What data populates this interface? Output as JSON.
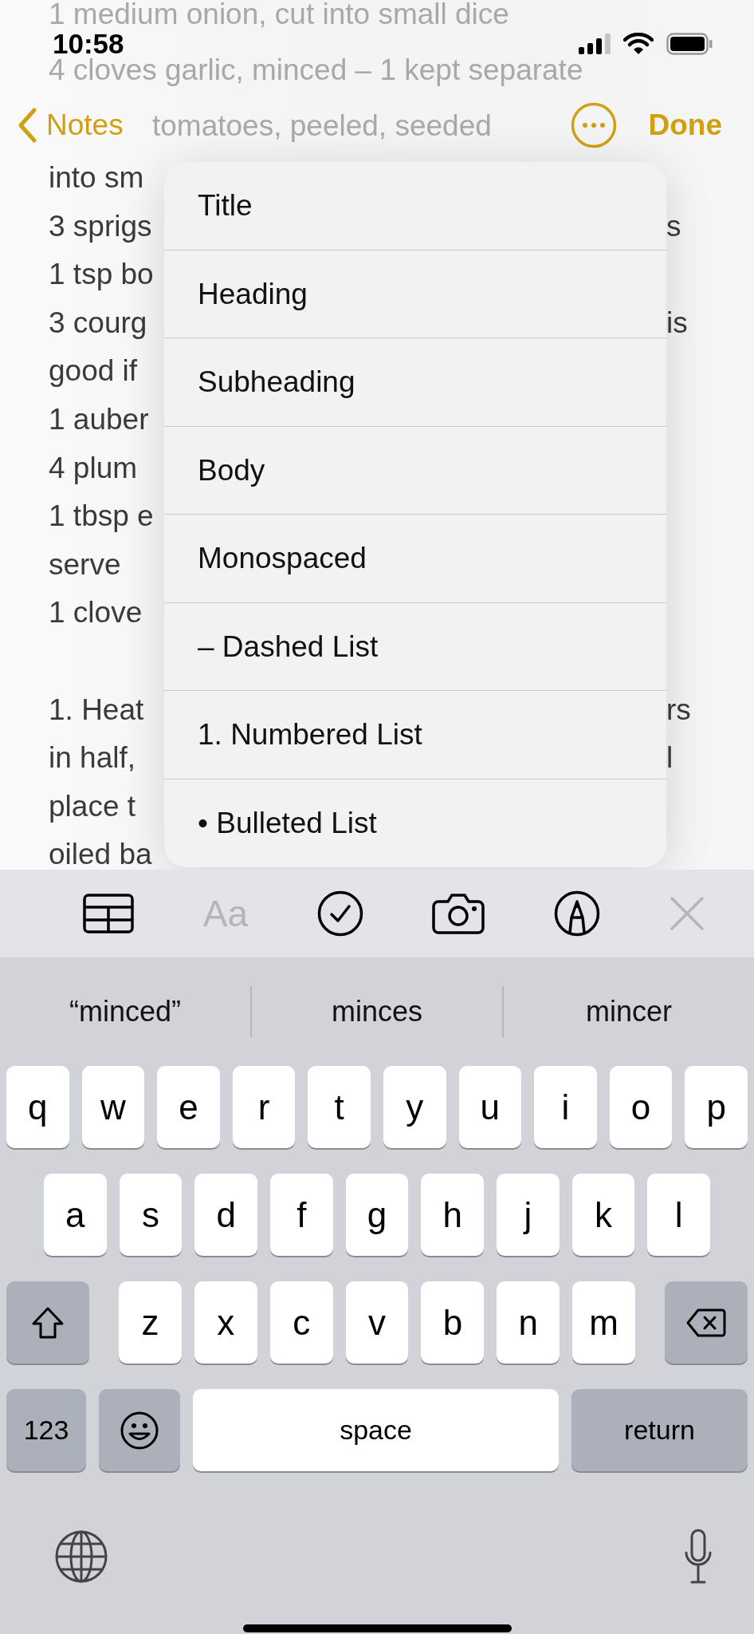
{
  "status_bar": {
    "time": "10:58"
  },
  "nav": {
    "back_label": "Notes",
    "done_label": "Done"
  },
  "note_lines": [
    {
      "kind": "ghost",
      "text": "1 medium onion, cut into small dice"
    },
    {
      "kind": "ghost",
      "text": "4 cloves garlic, minced – 1 kept separate"
    },
    {
      "kind": "ghost-after-nav",
      "text": "tomatoes, peeled, seeded"
    },
    {
      "kind": "text",
      "text": "into sm"
    },
    {
      "kind": "text",
      "text": "3 sprigs",
      "right": "s"
    },
    {
      "kind": "text",
      "text": "1 tsp bo"
    },
    {
      "kind": "text",
      "text": "3 courg",
      "right": "is"
    },
    {
      "kind": "text",
      "text": "good if"
    },
    {
      "kind": "text",
      "text": "1 auber"
    },
    {
      "kind": "text",
      "text": "4 plum"
    },
    {
      "kind": "text",
      "text": "1 tbsp e"
    },
    {
      "kind": "text",
      "text": "serve"
    },
    {
      "kind": "text",
      "text": "1 clove"
    },
    {
      "kind": "blank"
    },
    {
      "kind": "text",
      "text": "1. Heat",
      "right": "rs"
    },
    {
      "kind": "text",
      "text": "in half,",
      "right": "l"
    },
    {
      "kind": "text",
      "text": "place t"
    },
    {
      "kind": "text",
      "text": "oiled ba"
    }
  ],
  "format_menu": [
    "Title",
    "Heading",
    "Subheading",
    "Body",
    "Monospaced",
    "– Dashed List",
    "1. Numbered List",
    "• Bulleted List"
  ],
  "toolbar": [
    {
      "kind": "table"
    },
    {
      "kind": "format",
      "label": "Aa",
      "active": true
    },
    {
      "kind": "checklist"
    },
    {
      "kind": "camera"
    },
    {
      "kind": "markup"
    },
    {
      "kind": "close"
    }
  ],
  "suggestions": [
    "“minced”",
    "minces",
    "mincer"
  ],
  "keyboard": [
    [
      {
        "kind": "letter",
        "label": "q"
      },
      {
        "kind": "letter",
        "label": "w"
      },
      {
        "kind": "letter",
        "label": "e"
      },
      {
        "kind": "letter",
        "label": "r"
      },
      {
        "kind": "letter",
        "label": "t"
      },
      {
        "kind": "letter",
        "label": "y"
      },
      {
        "kind": "letter",
        "label": "u"
      },
      {
        "kind": "letter",
        "label": "i"
      },
      {
        "kind": "letter",
        "label": "o"
      },
      {
        "kind": "letter",
        "label": "p"
      }
    ],
    [
      {
        "kind": "letter",
        "label": "a"
      },
      {
        "kind": "letter",
        "label": "s"
      },
      {
        "kind": "letter",
        "label": "d"
      },
      {
        "kind": "letter",
        "label": "f"
      },
      {
        "kind": "letter",
        "label": "g"
      },
      {
        "kind": "letter",
        "label": "h"
      },
      {
        "kind": "letter",
        "label": "j"
      },
      {
        "kind": "letter",
        "label": "k"
      },
      {
        "kind": "letter",
        "label": "l"
      }
    ],
    [
      {
        "kind": "shift"
      },
      {
        "kind": "letter",
        "label": "z"
      },
      {
        "kind": "letter",
        "label": "x"
      },
      {
        "kind": "letter",
        "label": "c"
      },
      {
        "kind": "letter",
        "label": "v"
      },
      {
        "kind": "letter",
        "label": "b"
      },
      {
        "kind": "letter",
        "label": "n"
      },
      {
        "kind": "letter",
        "label": "m"
      },
      {
        "kind": "delete"
      }
    ],
    [
      {
        "kind": "mode",
        "label": "123"
      },
      {
        "kind": "emoji"
      },
      {
        "kind": "space",
        "label": "space"
      },
      {
        "kind": "return",
        "label": "return"
      }
    ]
  ]
}
